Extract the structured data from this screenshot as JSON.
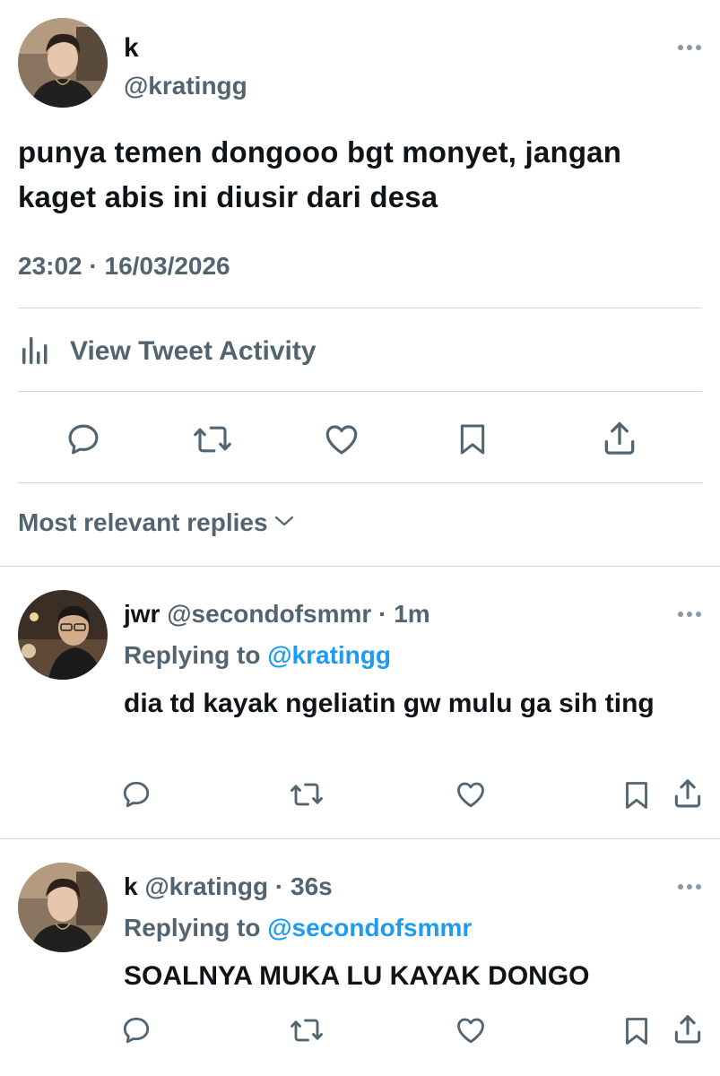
{
  "tweet": {
    "name": "k",
    "handle": "@kratingg",
    "text": "punya temen dongooo bgt monyet, jangan kaget abis ini diusir dari desa",
    "timestamp": "23:02 · 16/03/2026",
    "activity_label": "View Tweet Activity",
    "actions": [
      "reply-icon",
      "retweet-icon",
      "like-icon",
      "bookmark-icon",
      "share-icon"
    ]
  },
  "replies_sort": {
    "label": "Most relevant replies"
  },
  "replies": [
    {
      "name": "jwr",
      "handle": "@secondofsmmr",
      "separator": "·",
      "time": "1m",
      "replying_prefix": "Replying to",
      "replying_to": "@kratingg",
      "text": "dia td kayak ngeliatin gw mulu ga sih ting"
    },
    {
      "name": "k",
      "handle": "@kratingg",
      "separator": "·",
      "time": "36s",
      "replying_prefix": "Replying to",
      "replying_to": "@secondofsmmr",
      "text": "SOALNYA MUKA LU KAYAK DONGO"
    }
  ],
  "colors": {
    "text": "#0f1419",
    "secondary": "#536471",
    "link": "#1d9bf0",
    "divider": "#cfd9de"
  }
}
